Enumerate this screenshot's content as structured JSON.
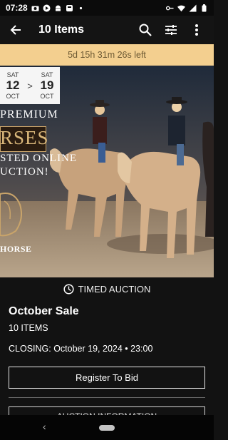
{
  "status": {
    "time": "07:28"
  },
  "app_bar": {
    "title": "10 Items"
  },
  "countdown": {
    "text": "5d 15h 31m 26s left"
  },
  "hero": {
    "date_start": {
      "dow": "SAT",
      "day": "12",
      "month": "OCT"
    },
    "date_arrow": ">",
    "date_end": {
      "dow": "SAT",
      "day": "19",
      "month": "OCT"
    },
    "line1": "PREMIUM",
    "line2": "RSES",
    "line3": "STED ONLINE",
    "line4": "UCTION!",
    "brand": "HORSE"
  },
  "auction": {
    "type_label": "TIMED AUCTION",
    "title": "October Sale",
    "items": "10 ITEMS",
    "closing": "CLOSING: October 19, 2024 • 23:00",
    "register_label": "Register To Bid",
    "info_label": "AUCTION INFORMATION"
  },
  "colors": {
    "countdown_bg": "#f3cf8f",
    "countdown_text": "#6d5a34",
    "page_bg": "#121212"
  }
}
